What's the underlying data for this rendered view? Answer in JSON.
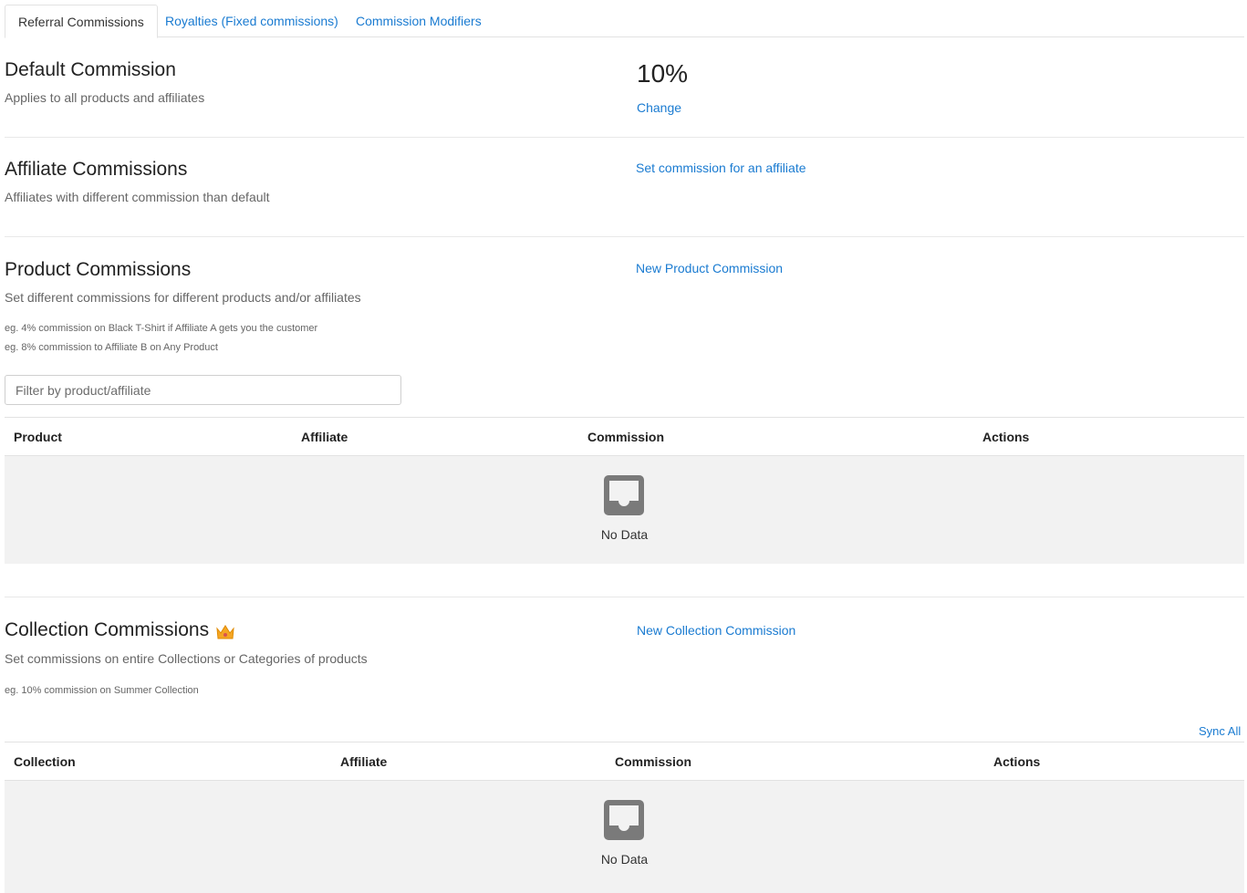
{
  "tabs": [
    {
      "label": "Referral Commissions",
      "active": true
    },
    {
      "label": "Royalties (Fixed commissions)",
      "active": false
    },
    {
      "label": "Commission Modifiers",
      "active": false
    }
  ],
  "default_commission": {
    "title": "Default Commission",
    "subtitle": "Applies to all products and affiliates",
    "value": "10%",
    "change_label": "Change"
  },
  "affiliate_commissions": {
    "title": "Affiliate Commissions",
    "subtitle": "Affiliates with different commission than default",
    "action_label": "Set commission for an affiliate"
  },
  "product_commissions": {
    "title": "Product Commissions",
    "subtitle": "Set different commissions for different products and/or affiliates",
    "examples": [
      "eg. 4% commission on Black T-Shirt if Affiliate A gets you the customer",
      "eg. 8% commission to Affiliate B on Any Product"
    ],
    "action_label": "New Product Commission",
    "filter_placeholder": "Filter by product/affiliate",
    "columns": [
      "Product",
      "Affiliate",
      "Commission",
      "Actions"
    ],
    "empty_text": "No Data"
  },
  "collection_commissions": {
    "title": "Collection Commissions",
    "premium_icon": "crown-icon",
    "subtitle": "Set commissions on entire Collections or Categories of products",
    "examples": [
      "eg. 10% commission on Summer Collection"
    ],
    "action_label": "New Collection Commission",
    "sync_label": "Sync All",
    "columns": [
      "Collection",
      "Affiliate",
      "Commission",
      "Actions"
    ],
    "empty_text": "No Data"
  },
  "colors": {
    "link": "#1a7bd1",
    "empty_bg": "#f2f2f2",
    "empty_icon": "#7a7a7a",
    "crown": "#f5a623"
  }
}
